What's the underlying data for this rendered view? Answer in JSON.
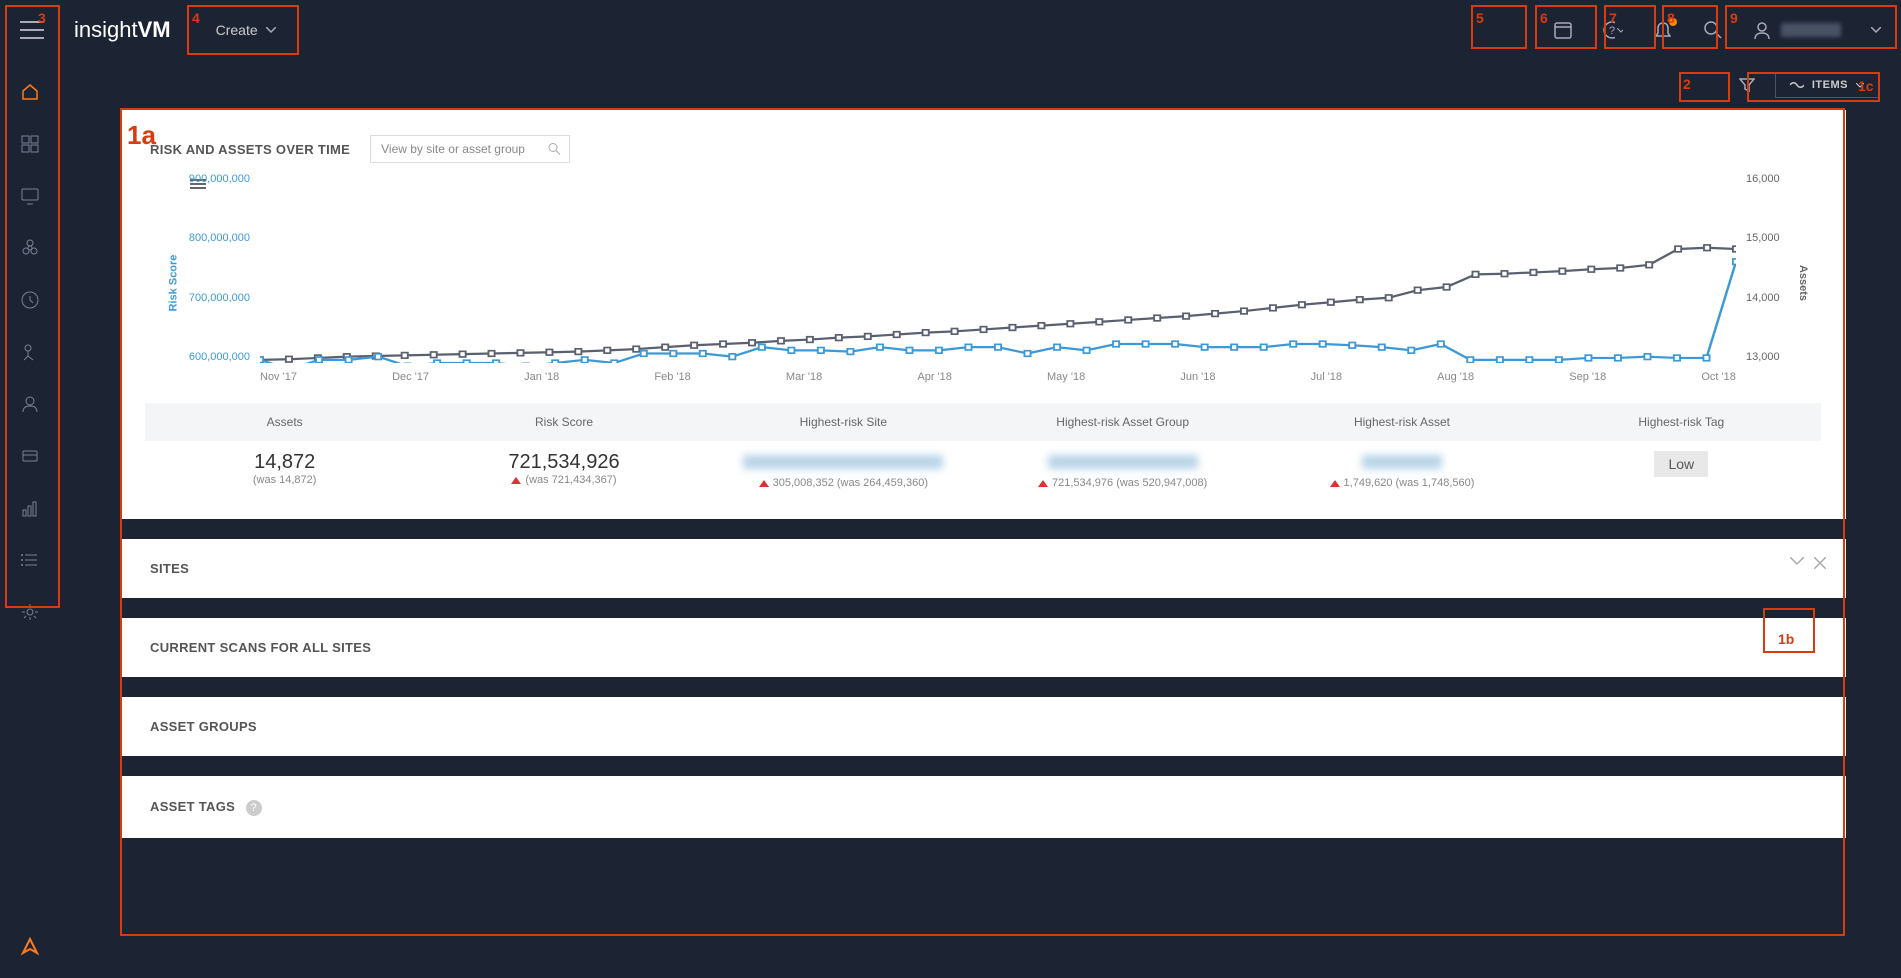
{
  "brand": {
    "part1": "insight",
    "part2": "VM"
  },
  "topbar": {
    "create_label": "Create",
    "items_label": "ITEMS"
  },
  "chart_panel": {
    "title": "RISK AND ASSETS OVER TIME",
    "search_placeholder": "View by site or asset group",
    "y_left_label": "Risk Score",
    "y_right_label": "Assets"
  },
  "chart_data": {
    "type": "line",
    "x_categories": [
      "Nov '17",
      "Dec '17",
      "Jan '18",
      "Feb '18",
      "Mar '18",
      "Apr '18",
      "May '18",
      "Jun '18",
      "Jul '18",
      "Aug '18",
      "Sep '18",
      "Oct '18"
    ],
    "y_left_ticks": [
      "900,000,000",
      "800,000,000",
      "700,000,000",
      "600,000,000"
    ],
    "y_right_ticks": [
      "16,000",
      "15,000",
      "14,000",
      "13,000"
    ],
    "y_left_range": [
      600000000,
      900000000
    ],
    "y_right_range": [
      13000,
      16000
    ],
    "series": [
      {
        "name": "Risk Score",
        "axis": "left",
        "color": "#3d99d6",
        "values": [
          605000000,
          590000000,
          605000000,
          605000000,
          610000000,
          595000000,
          600000000,
          600000000,
          600000000,
          595000000,
          600000000,
          605000000,
          600000000,
          615000000,
          615000000,
          615000000,
          610000000,
          625000000,
          620000000,
          620000000,
          618000000,
          625000000,
          620000000,
          620000000,
          625000000,
          625000000,
          615000000,
          625000000,
          620000000,
          630000000,
          630000000,
          630000000,
          625000000,
          625000000,
          625000000,
          630000000,
          630000000,
          628000000,
          625000000,
          620000000,
          630000000,
          605000000,
          605000000,
          605000000,
          605000000,
          608000000,
          608000000,
          610000000,
          608000000,
          608000000,
          760000000
        ]
      },
      {
        "name": "Assets",
        "axis": "right",
        "color": "#5a6070",
        "values": [
          13050,
          13060,
          13080,
          13100,
          13110,
          13120,
          13130,
          13140,
          13150,
          13160,
          13170,
          13180,
          13200,
          13220,
          13250,
          13280,
          13300,
          13320,
          13350,
          13370,
          13400,
          13420,
          13450,
          13480,
          13500,
          13530,
          13560,
          13590,
          13620,
          13650,
          13680,
          13710,
          13740,
          13780,
          13820,
          13870,
          13920,
          13960,
          14000,
          14030,
          14150,
          14200,
          14400,
          14410,
          14430,
          14450,
          14480,
          14500,
          14550,
          14800,
          14820,
          14800
        ]
      }
    ]
  },
  "stats": {
    "headers": [
      "Assets",
      "Risk Score",
      "Highest-risk Site",
      "Highest-risk Asset Group",
      "Highest-risk Asset",
      "Highest-risk Tag"
    ],
    "assets": {
      "value": "14,872",
      "sub": "(was 14,872)"
    },
    "risk": {
      "value": "721,534,926",
      "sub": "(was 721,434,367)"
    },
    "site": {
      "sub": "305,008,352 (was 264,459,360)"
    },
    "group": {
      "sub": "721,534,976 (was 520,947,008)"
    },
    "asset": {
      "sub": "1,749,620 (was 1,748,560)"
    },
    "tag": {
      "badge": "Low"
    }
  },
  "sections": {
    "sites": "SITES",
    "scans": "CURRENT SCANS FOR ALL SITES",
    "groups": "ASSET GROUPS",
    "tags": "ASSET TAGS"
  },
  "annotations": {
    "a1a": "1a",
    "a1b": "1b",
    "a1c": "1c",
    "a2": "2",
    "a3": "3",
    "a4": "4",
    "a5": "5",
    "a6": "6",
    "a7": "7",
    "a8": "8",
    "a9": "9"
  }
}
